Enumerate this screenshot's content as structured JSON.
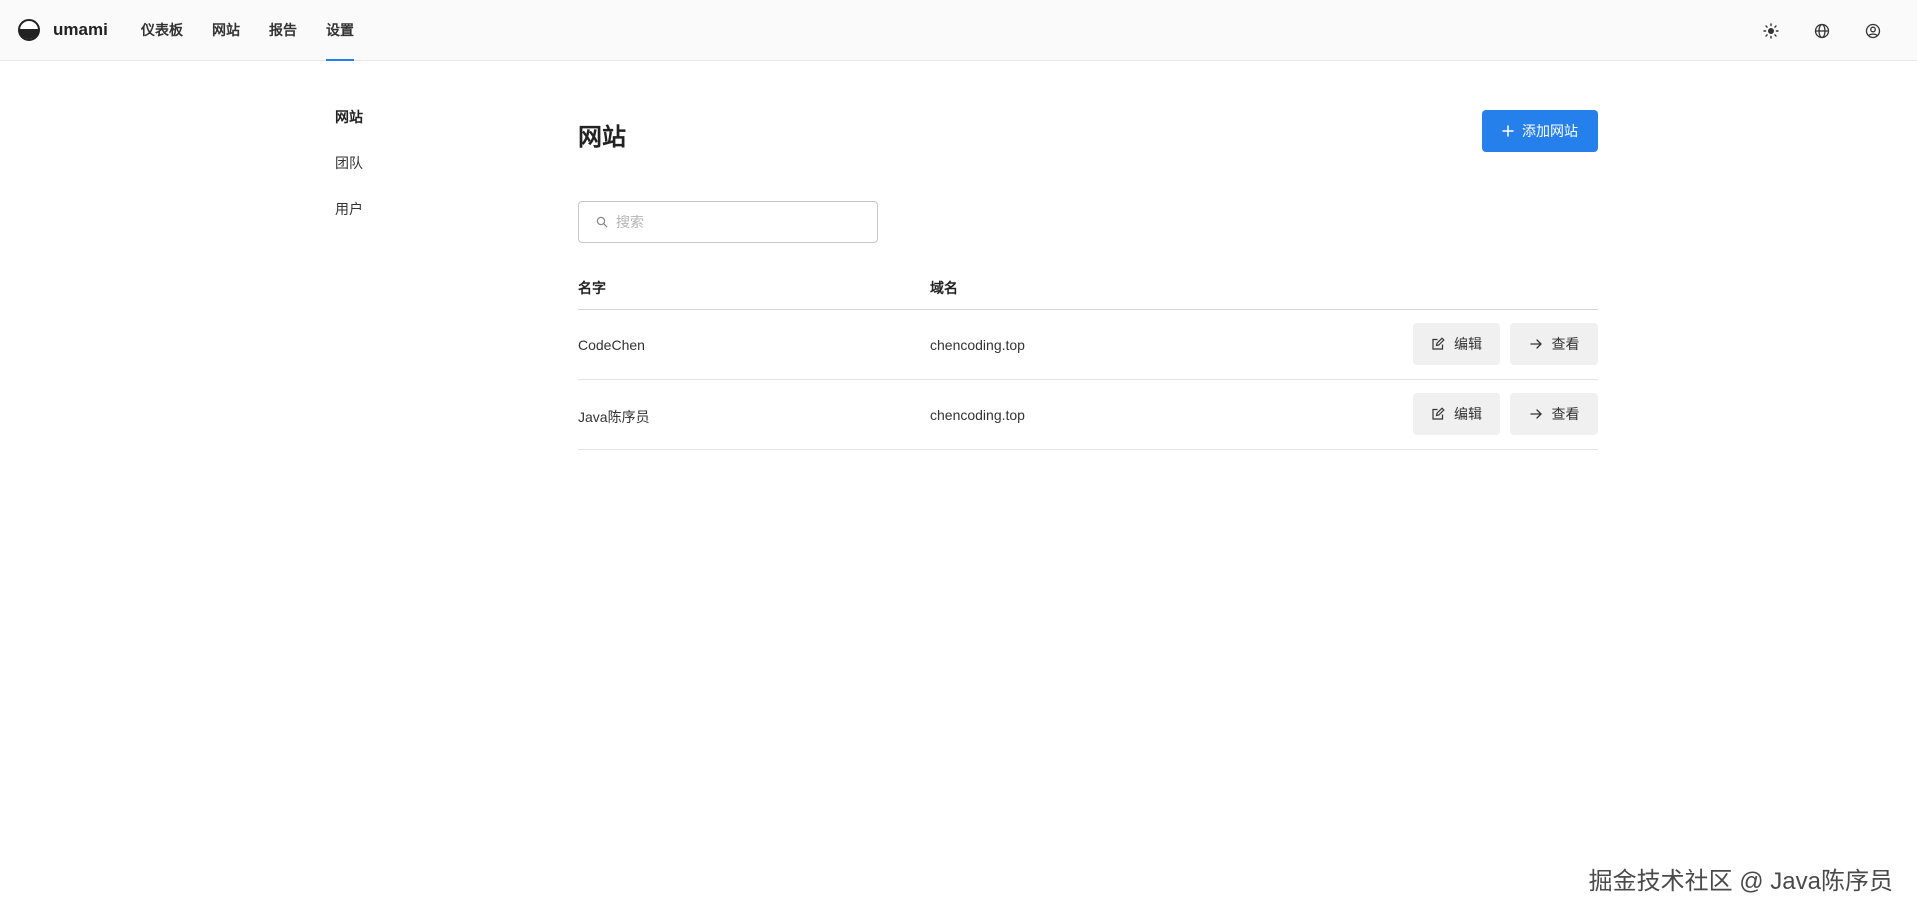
{
  "app": {
    "name": "umami"
  },
  "nav": {
    "items": [
      {
        "label": "仪表板",
        "active": false
      },
      {
        "label": "网站",
        "active": false
      },
      {
        "label": "报告",
        "active": false
      },
      {
        "label": "设置",
        "active": true
      }
    ]
  },
  "top_icons": [
    "sun-icon",
    "globe-icon",
    "user-circle-icon"
  ],
  "sidebar": {
    "items": [
      {
        "label": "网站",
        "active": true
      },
      {
        "label": "团队",
        "active": false
      },
      {
        "label": "用户",
        "active": false
      }
    ]
  },
  "main": {
    "title": "网站",
    "add_button": "添加网站",
    "search": {
      "placeholder": "搜索",
      "value": ""
    },
    "table": {
      "columns": [
        "名字",
        "域名"
      ],
      "rows": [
        {
          "name": "CodeChen",
          "domain": "chencoding.top",
          "edit": "编辑",
          "view": "查看"
        },
        {
          "name": "Java陈序员",
          "domain": "chencoding.top",
          "edit": "编辑",
          "view": "查看"
        }
      ]
    }
  },
  "watermark": "掘金技术社区 @ Java陈序员",
  "colors": {
    "accent": "#2680eb",
    "topbar_bg": "#fafafa"
  }
}
